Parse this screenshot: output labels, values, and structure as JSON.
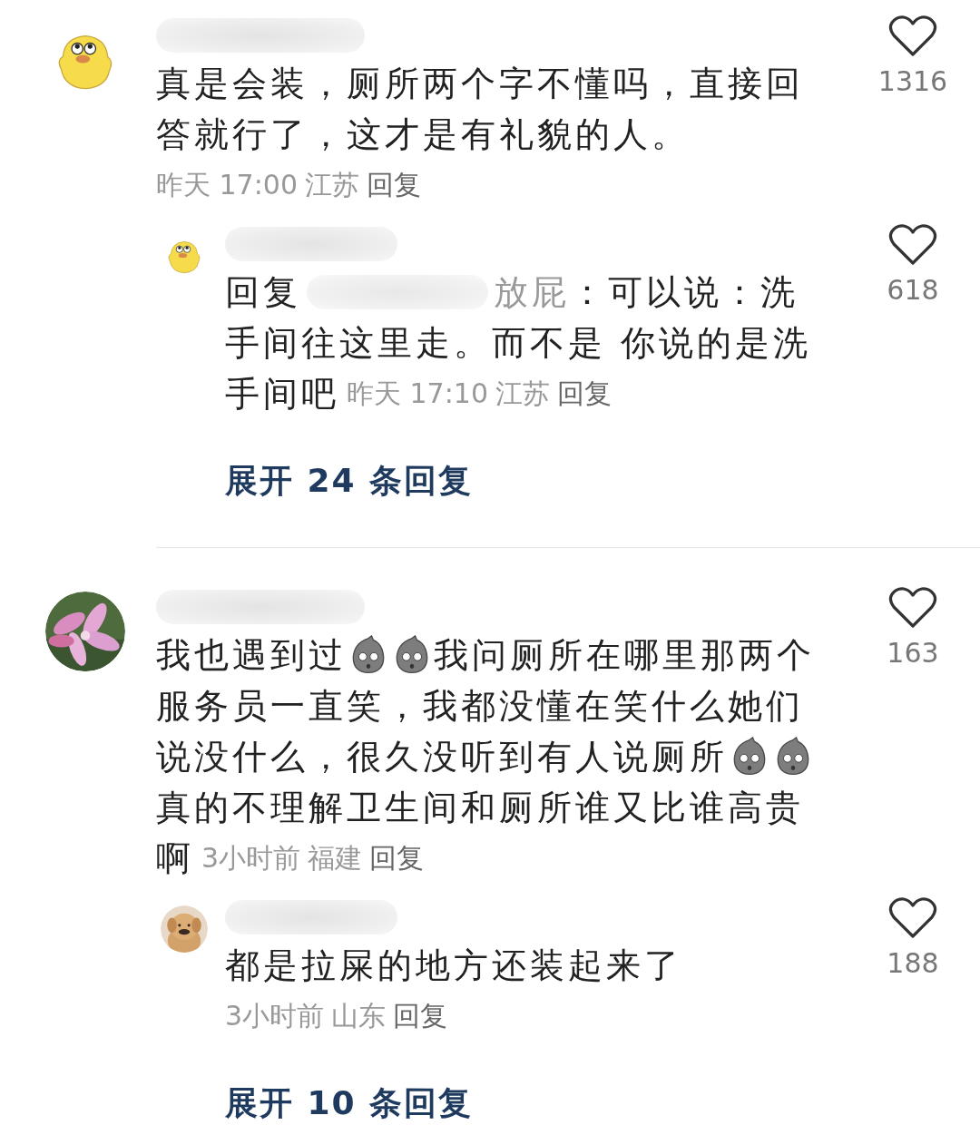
{
  "comments": [
    {
      "avatar": {
        "kind": "duck"
      },
      "lines": [
        [
          {
            "kind": "text",
            "text": "真是会装，厕所两个字不懂吗，直接回"
          }
        ],
        [
          {
            "kind": "text",
            "text": "答就行了，这才是有礼貌的人。"
          }
        ],
        [
          {
            "kind": "meta"
          }
        ]
      ],
      "time": "昨天 17:00",
      "location": "江苏",
      "reply_label": "回复",
      "likes": "1316",
      "replies": [
        {
          "avatar": {
            "kind": "duck"
          },
          "lines": [
            [
              {
                "kind": "text",
                "text": "回复"
              },
              {
                "kind": "mention",
                "text": "放屁"
              },
              {
                "kind": "text",
                "text": "：可以说：洗"
              }
            ],
            [
              {
                "kind": "text",
                "text": "手间往这里走。而不是 你说的是洗"
              }
            ],
            [
              {
                "kind": "text",
                "text": "手间吧"
              },
              {
                "kind": "meta"
              }
            ]
          ],
          "time": "昨天 17:10",
          "location": "江苏",
          "reply_label": "回复",
          "likes": "618"
        }
      ],
      "expand": "展开 24 条回复"
    },
    {
      "avatar": {
        "kind": "picture"
      },
      "lines": [
        [
          {
            "kind": "text",
            "text": "我也遇到过"
          },
          {
            "kind": "emoji"
          },
          {
            "kind": "emoji"
          },
          {
            "kind": "text",
            "text": "我问厕所在哪里那两个"
          }
        ],
        [
          {
            "kind": "text",
            "text": "服务员一直笑，我都没懂在笑什么她们"
          }
        ],
        [
          {
            "kind": "text",
            "text": "说没什么，很久没听到有人说厕所"
          },
          {
            "kind": "emoji"
          },
          {
            "kind": "emoji"
          }
        ],
        [
          {
            "kind": "text",
            "text": "真的不理解卫生间和厕所谁又比谁高贵"
          }
        ],
        [
          {
            "kind": "text",
            "text": "啊"
          },
          {
            "kind": "meta"
          }
        ]
      ],
      "time": "3小时前",
      "location": "福建",
      "reply_label": "回复",
      "likes": "163",
      "replies": [
        {
          "avatar": {
            "kind": "picture"
          },
          "lines": [
            [
              {
                "kind": "text",
                "text": "都是拉屎的地方还装起来了"
              }
            ],
            [
              {
                "kind": "meta"
              }
            ]
          ],
          "time": "3小时前",
          "location": "山东",
          "reply_label": "回复",
          "likes": "188"
        }
      ],
      "expand": "展开 10 条回复"
    }
  ]
}
